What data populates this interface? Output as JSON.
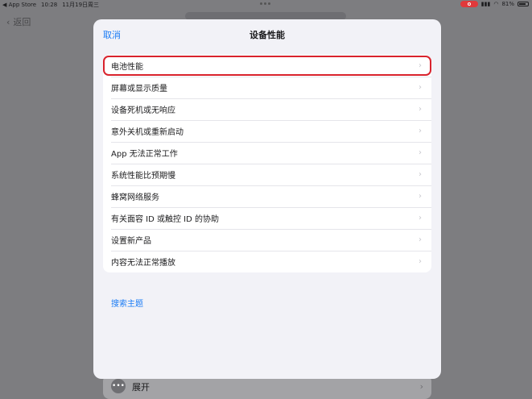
{
  "status_bar": {
    "app_back": "◀ App Store",
    "time": "10:28",
    "date": "11月19日周三",
    "battery_percent": "81%",
    "battery_level": 0.81
  },
  "background": {
    "back_label": "返回",
    "expand_label": "展开"
  },
  "modal": {
    "cancel_label": "取消",
    "title": "设备性能",
    "items": [
      {
        "label": "电池性能",
        "highlighted": true
      },
      {
        "label": "屏幕或显示质量"
      },
      {
        "label": "设备死机或无响应"
      },
      {
        "label": "意外关机或重新启动"
      },
      {
        "label": "App 无法正常工作"
      },
      {
        "label": "系统性能比预期慢"
      },
      {
        "label": "蜂窝网络服务"
      },
      {
        "label": "有关面容 ID 或触控 ID 的协助"
      },
      {
        "label": "设置新产品"
      },
      {
        "label": "内容无法正常播放"
      }
    ],
    "search_label": "搜索主题"
  },
  "colors": {
    "accent": "#1b7cf5",
    "highlight": "#d9232d",
    "recording": "#e0393b"
  }
}
